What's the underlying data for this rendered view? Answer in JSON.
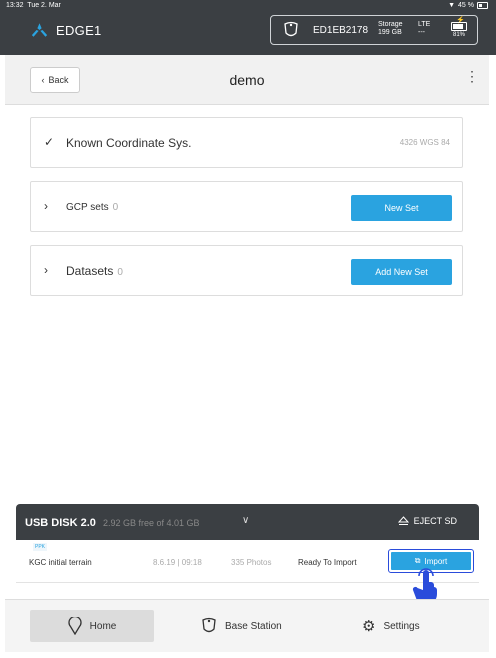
{
  "status_bar": {
    "time": "13:32",
    "date": "Tue 2. Mar",
    "battery_pct": "45 %"
  },
  "header": {
    "app_name": "EDGE1",
    "device_id": "ED1EB2178",
    "storage_label": "Storage",
    "storage_value": "199 GB",
    "lte_label": "LTE",
    "lte_value": "---",
    "battery": "81%",
    "icons": {
      "logo": "edge-logo-icon",
      "drone": "drone-icon",
      "battery": "battery-icon"
    }
  },
  "nav": {
    "back_label": "Back",
    "title": "demo"
  },
  "cards": {
    "coordinate": {
      "title": "Known Coordinate Sys.",
      "value": "4326 WGS 84"
    },
    "gcp": {
      "title": "GCP sets",
      "count": "0",
      "button": "New Set"
    },
    "datasets": {
      "title": "Datasets",
      "count": "0",
      "button": "Add New Set"
    }
  },
  "usb": {
    "name": "USB DISK 2.0",
    "free": "2.92 GB free of 4.01 GB",
    "eject_label": "EJECT SD",
    "rows": [
      {
        "tag": "PPK",
        "name": "KGC initial terrain",
        "date": "8.6.19 | 09:18",
        "photos": "335 Photos",
        "status": "Ready To Import",
        "action": "Import"
      }
    ]
  },
  "bottom_nav": {
    "home": "Home",
    "base_station": "Base Station",
    "settings": "Settings"
  },
  "colors": {
    "header_bg": "#3b3f43",
    "accent": "#2aa3e0",
    "highlight": "#2a4cdb"
  }
}
